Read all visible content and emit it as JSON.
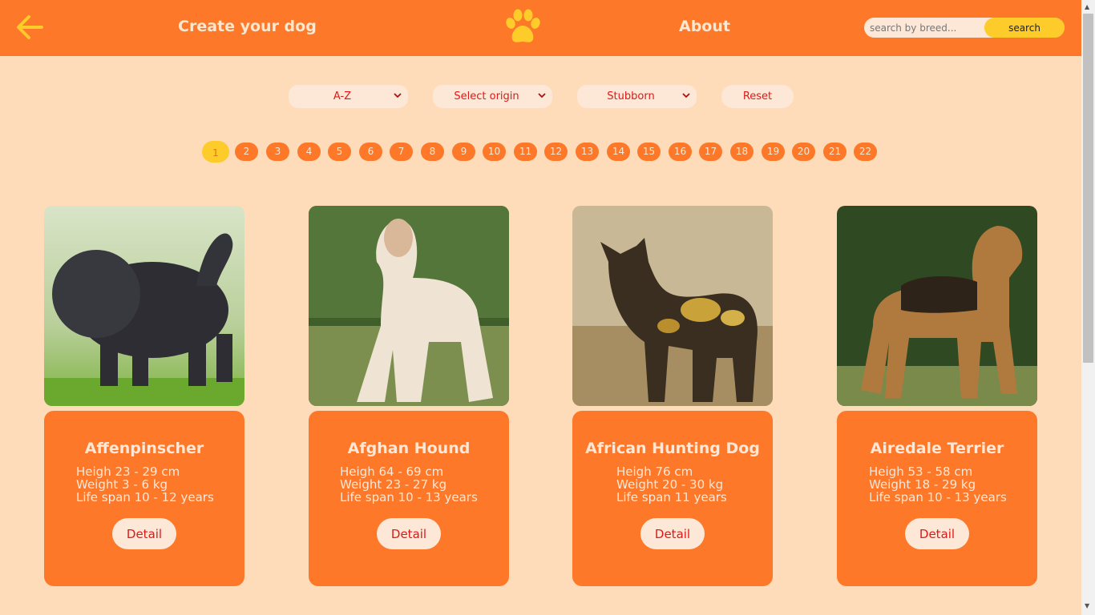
{
  "navbar": {
    "create_label": "Create your dog",
    "about_label": "About",
    "search": {
      "placeholder": "search by breed...",
      "button_label": "search"
    }
  },
  "filters": {
    "sort_selected": "A-Z",
    "origin_selected": "Select origin",
    "temperament_selected": "Stubborn",
    "reset_label": "Reset"
  },
  "pagination": {
    "current": 1,
    "pages": [
      "1",
      "2",
      "3",
      "4",
      "5",
      "6",
      "7",
      "8",
      "9",
      "10",
      "11",
      "12",
      "13",
      "14",
      "15",
      "16",
      "17",
      "18",
      "19",
      "20",
      "21",
      "22"
    ]
  },
  "cards": [
    {
      "name": "Affenpinscher",
      "height": "Heigh 23 - 29 cm",
      "weight": "Weight 3 - 6 kg",
      "life_span": "Life span 10 - 12 years",
      "detail_label": "Detail"
    },
    {
      "name": "Afghan Hound",
      "height": "Heigh 64 - 69 cm",
      "weight": "Weight 23 - 27 kg",
      "life_span": "Life span 10 - 13 years",
      "detail_label": "Detail"
    },
    {
      "name": "African Hunting Dog",
      "height": "Heigh 76 cm",
      "weight": "Weight 20 - 30 kg",
      "life_span": "Life span 11 years",
      "detail_label": "Detail"
    },
    {
      "name": "Airedale Terrier",
      "height": "Heigh 53 - 58 cm",
      "weight": "Weight 18 - 29 kg",
      "life_span": "Life span 10 - 13 years",
      "detail_label": "Detail"
    }
  ],
  "icons": {
    "back": "arrow-left-icon",
    "logo": "paw-icon",
    "chevron": "chevron-down-icon"
  },
  "colors": {
    "primary": "#fd7828",
    "background": "#ffdcb9",
    "accent": "#fdcb2a",
    "text_red": "#e01818",
    "cream": "#fde7d6"
  }
}
